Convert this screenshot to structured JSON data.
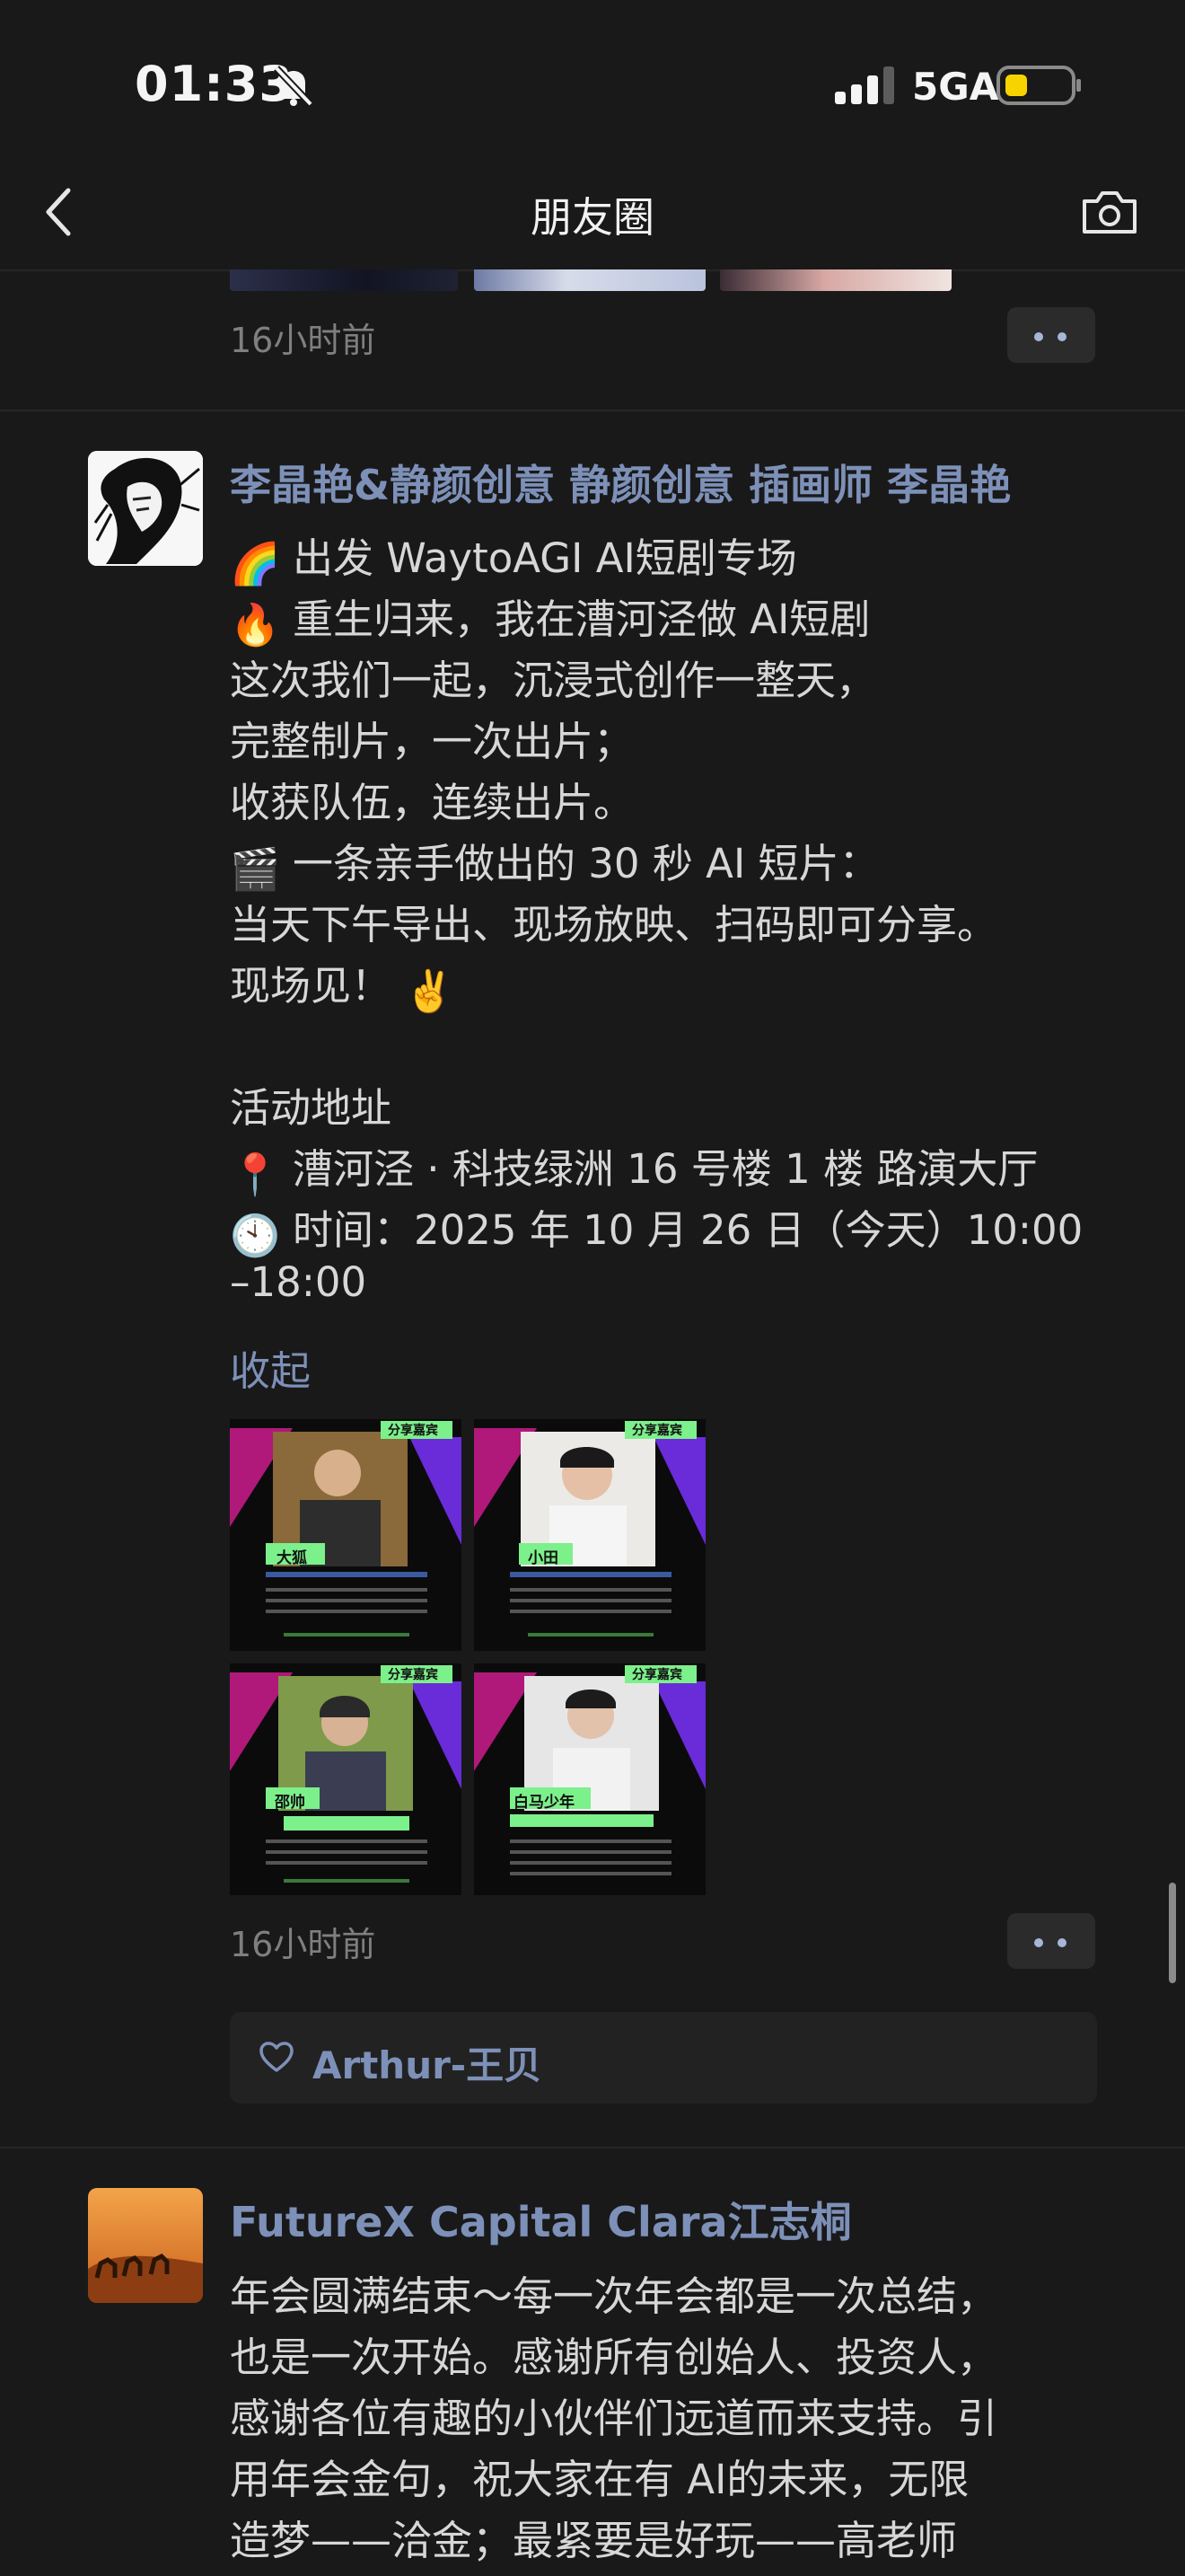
{
  "status_bar": {
    "time": "01:33",
    "network": "5GA",
    "battery_color": "#f7d400"
  },
  "nav": {
    "title": "朋友圈"
  },
  "previous_post": {
    "time": "16小时前"
  },
  "post1": {
    "author": "李晶艳&静颜创意 静颜创意 插画师 李晶艳",
    "lines": [
      "出发 WaytoAGI AI短剧专场",
      "重生归来，我在漕河泾做 AI短剧",
      "这次我们一起，沉浸式创作一整天，",
      "完整制片，一次出片；",
      "收获队伍，连续出片。",
      "一条亲手做出的 30 秒 AI 短片：",
      "当天下午导出、现场放映、扫码即可分享。",
      "现场见！",
      "活动地址",
      "漕河泾 · 科技绿洲 16 号楼 1 楼 路演大厅",
      "时间：2025 年 10 月 26 日（今天）10:00",
      "–18:00"
    ],
    "emoji": [
      "🌈",
      "🔥",
      "🎬",
      "✌️",
      "📍",
      "🕙"
    ],
    "collapse_label": "收起",
    "photos": [
      {
        "tag": "分享嘉宾",
        "name": "大狐"
      },
      {
        "tag": "分享嘉宾",
        "name": "小田"
      },
      {
        "tag": "分享嘉宾",
        "name": "邵帅"
      },
      {
        "tag": "分享嘉宾",
        "name": "白马少年"
      }
    ],
    "time": "16小时前",
    "likes": "Arthur-王贝"
  },
  "post2": {
    "author": "FutureX Capital Clara江志桐",
    "lines": [
      "年会圆满结束～每一次年会都是一次总结，",
      "也是一次开始。感谢所有创始人、投资人，",
      "感谢各位有趣的小伙伴们远道而来支持。引",
      "用年会金句，祝大家在有 AI的未来，无限",
      "造梦——洽金；最紧要是好玩——高老师"
    ]
  }
}
